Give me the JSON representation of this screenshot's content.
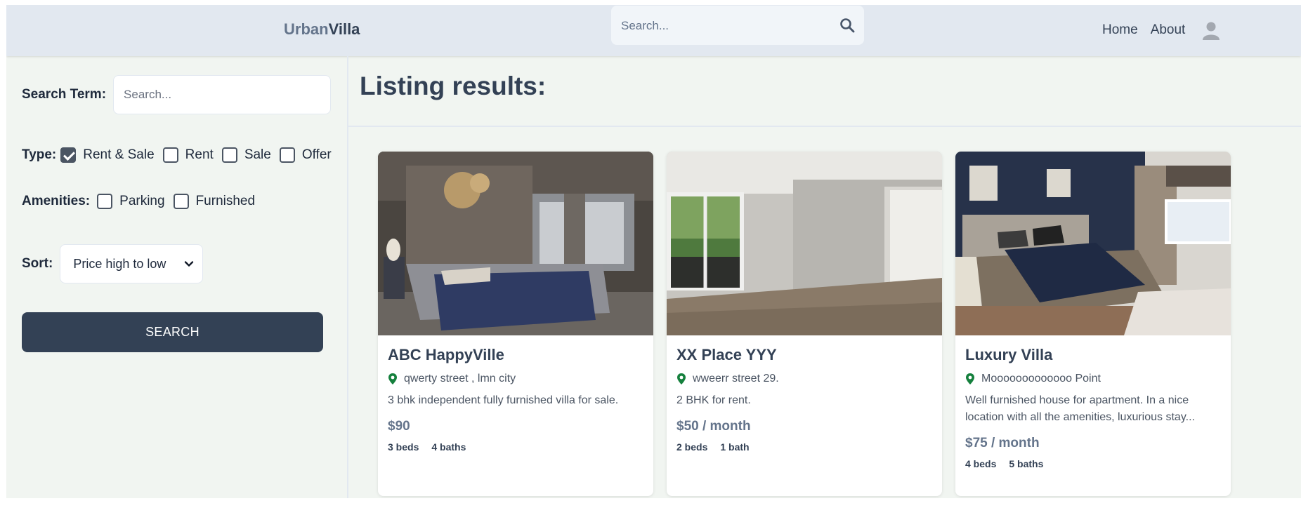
{
  "header": {
    "logo_part1": "Urban",
    "logo_part2": "Villa",
    "search_placeholder": "Search...",
    "nav": [
      "Home",
      "About"
    ]
  },
  "sidebar": {
    "search_label": "Search Term:",
    "search_placeholder": "Search...",
    "type_label": "Type:",
    "type_options": [
      {
        "label": "Rent & Sale",
        "checked": true
      },
      {
        "label": "Rent",
        "checked": false
      },
      {
        "label": "Sale",
        "checked": false
      },
      {
        "label": "Offer",
        "checked": false
      }
    ],
    "amenities_label": "Amenities:",
    "amenities_options": [
      {
        "label": "Parking",
        "checked": false
      },
      {
        "label": "Furnished",
        "checked": false
      }
    ],
    "sort_label": "Sort:",
    "sort_value": "Price high to low",
    "search_button": "SEARCH"
  },
  "main": {
    "title": "Listing results:",
    "listings": [
      {
        "title": "ABC HappyVille",
        "location": "qwerty street , lmn city",
        "description": "3 bhk independent fully furnished villa for sale.",
        "price": "$90",
        "beds": "3 beds",
        "baths": "4 baths"
      },
      {
        "title": "XX Place YYY",
        "location": "wweerr street 29.",
        "description": "2 BHK for rent.",
        "price": "$50 / month",
        "beds": "2 beds",
        "baths": "1 bath"
      },
      {
        "title": "Luxury Villa",
        "location": "Mooooooooooooo Point",
        "description": "Well furnished house for apartment. In a nice location with all the amenities, luxurious stay...",
        "price": "$75 / month",
        "beds": "4 beds",
        "baths": "5 baths"
      }
    ]
  },
  "colors": {
    "accent": "#334155",
    "header_bg": "#e2e8f0",
    "page_bg": "#f1f5f1",
    "pin": "#15803d"
  },
  "icons": [
    "search-icon",
    "user-avatar-icon",
    "chevron-down-icon",
    "map-pin-icon",
    "checkmark-icon"
  ]
}
